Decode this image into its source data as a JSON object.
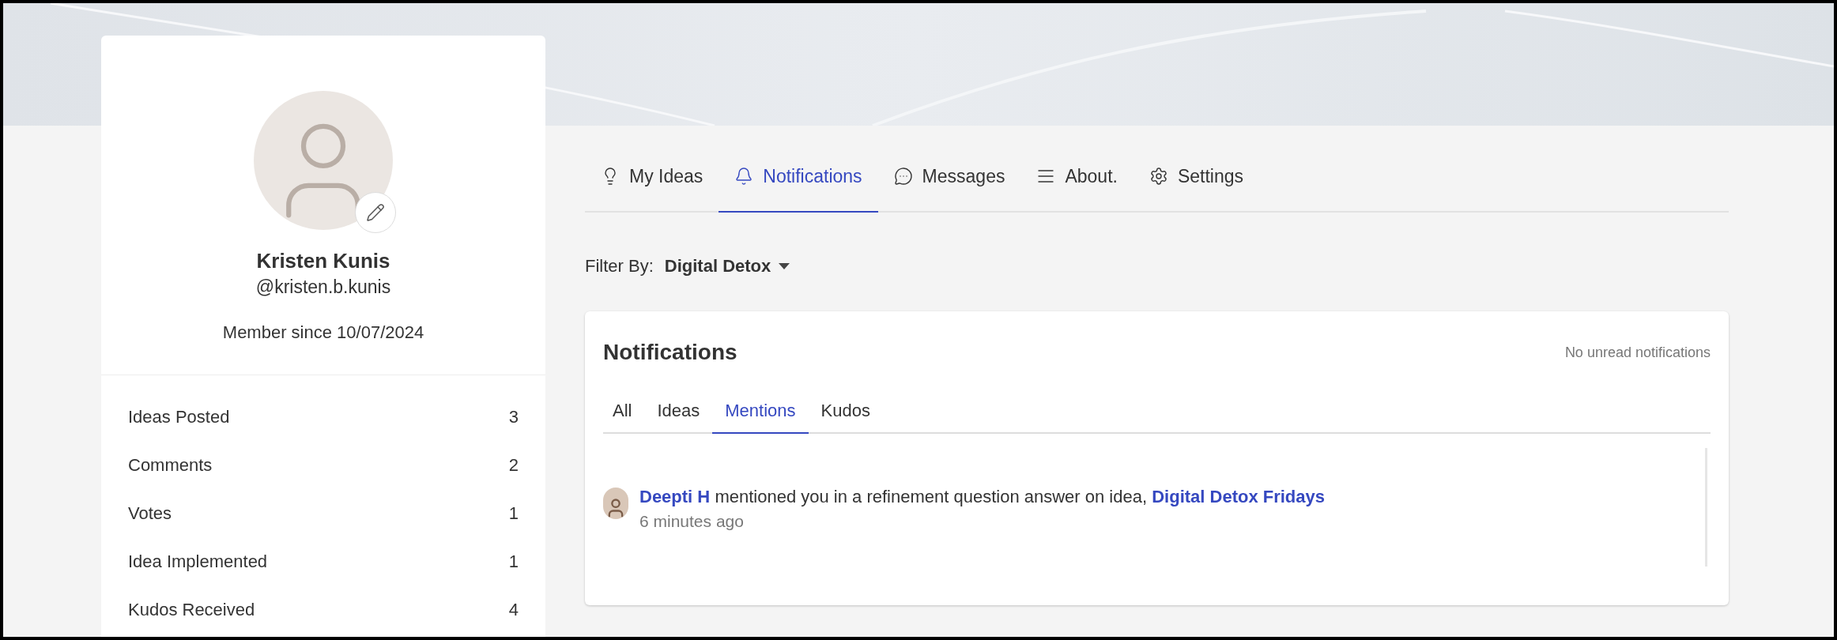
{
  "profile": {
    "name": "Kristen Kunis",
    "handle": "@kristen.b.kunis",
    "member_since": "Member since 10/07/2024",
    "stats": [
      {
        "label": "Ideas Posted",
        "value": "3"
      },
      {
        "label": "Comments",
        "value": "2"
      },
      {
        "label": "Votes",
        "value": "1"
      },
      {
        "label": "Idea Implemented",
        "value": "1"
      },
      {
        "label": "Kudos Received",
        "value": "4"
      }
    ]
  },
  "tabs": [
    {
      "label": "My Ideas",
      "selected": false
    },
    {
      "label": "Notifications",
      "selected": true
    },
    {
      "label": "Messages",
      "selected": false
    },
    {
      "label": "About.",
      "selected": false
    },
    {
      "label": "Settings",
      "selected": false
    }
  ],
  "filter": {
    "label": "Filter By:",
    "value": "Digital Detox"
  },
  "notifications": {
    "title": "Notifications",
    "status": "No unread notifications",
    "tabs": [
      {
        "label": "All",
        "selected": false
      },
      {
        "label": "Ideas",
        "selected": false
      },
      {
        "label": "Mentions",
        "selected": true
      },
      {
        "label": "Kudos",
        "selected": false
      }
    ],
    "items": [
      {
        "author": "Deepti H",
        "text": "mentioned you in a refinement question answer on idea,",
        "link": "Digital Detox Fridays",
        "time": "6 minutes ago"
      }
    ]
  }
}
